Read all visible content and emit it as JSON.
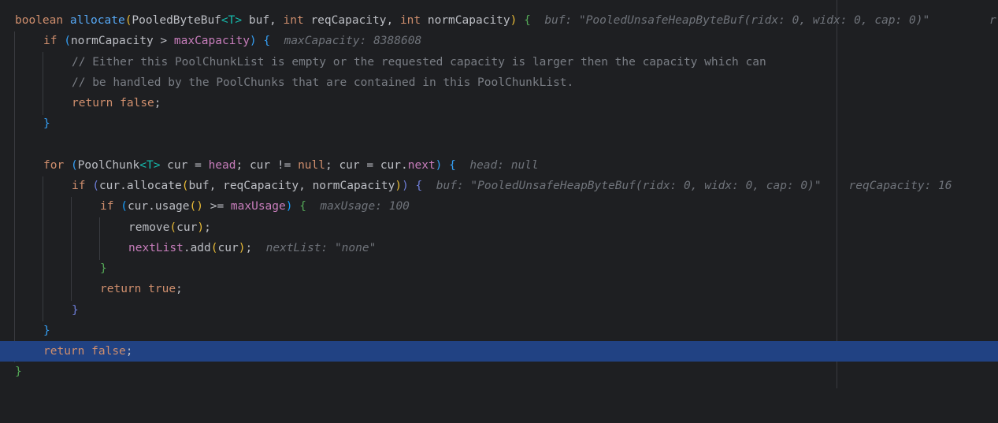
{
  "editor": {
    "lines": [
      {
        "kw1": "boolean",
        "fn": "allocate",
        "p_open": "(",
        "type": "PooledByteBuf",
        "lt": "<",
        "tp": "T",
        "gt": ">",
        "rest1": " buf, ",
        "kw2": "int",
        "rest2": " reqCapacity, ",
        "kw3": "int",
        "rest3": " normCapacity",
        "p_close": ")",
        "brace": "{",
        "hint": "buf: \"PooledUnsafeHeapByteBuf(ridx: 0, widx: 0, cap: 0)\"",
        "hint2": "r"
      },
      {
        "kw": "if",
        "p_open": "(",
        "a": "normCapacity > ",
        "field": "maxCapacity",
        "p_close": ")",
        "brace": "{",
        "hint": "maxCapacity: 8388608"
      },
      {
        "comment": "// Either this PoolChunkList is empty or the requested capacity is larger then the capacity which can"
      },
      {
        "comment": "// be handled by the PoolChunks that are contained in this PoolChunkList."
      },
      {
        "kw": "return",
        "kw2": "false",
        "semi": ";"
      },
      {
        "brace": "}"
      },
      {},
      {
        "kw": "for",
        "p_open": "(",
        "a": "PoolChunk",
        "lt": "<",
        "tp": "T",
        "gt": ">",
        "b": " cur = ",
        "field": "head",
        "c": "; cur != ",
        "kw2": "null",
        "d": "; cur = cur.",
        "field2": "next",
        "p_close": ")",
        "brace": "{",
        "hint": "head: null"
      },
      {
        "kw": "if",
        "p_open": "(",
        "a": "cur.allocate",
        "p2_open": "(",
        "b": "buf, reqCapacity, normCapacity",
        "p2_close": ")",
        "p_close": ")",
        "brace": "{",
        "hint": "buf: \"PooledUnsafeHeapByteBuf(ridx: 0, widx: 0, cap: 0)\"",
        "hint2": "reqCapacity: 16"
      },
      {
        "kw": "if",
        "p_open": "(",
        "a": "cur.usage",
        "p2": "()",
        "b": " >= ",
        "field": "maxUsage",
        "p_close": ")",
        "brace": "{",
        "hint": "maxUsage: 100"
      },
      {
        "a": "remove",
        "p_open": "(",
        "b": "cur",
        "p_close": ")",
        "semi": ";"
      },
      {
        "field": "nextList",
        "a": ".add",
        "p_open": "(",
        "b": "cur",
        "p_close": ")",
        "semi": ";",
        "hint": "nextList: \"none\""
      },
      {
        "brace": "}"
      },
      {
        "kw": "return",
        "kw2": "true",
        "semi": ";"
      },
      {
        "brace": "}"
      },
      {
        "brace": "}"
      },
      {
        "kw": "return",
        "kw2": "false",
        "semi": ";"
      },
      {
        "brace": "}"
      }
    ]
  }
}
